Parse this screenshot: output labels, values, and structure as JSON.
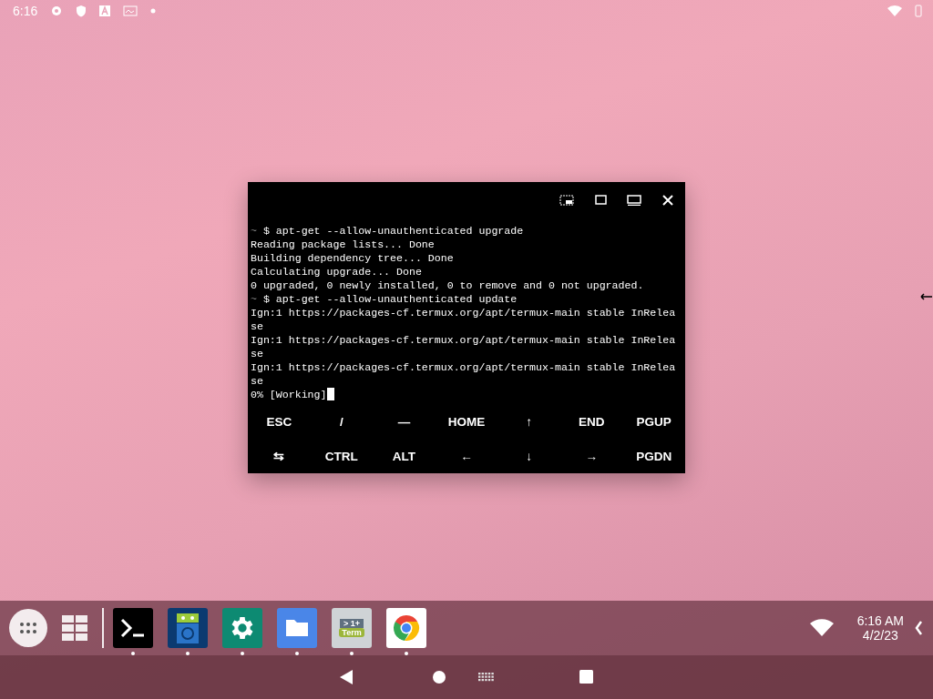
{
  "status_bar": {
    "time": "6:16"
  },
  "terminal": {
    "lines": [
      {
        "prompt": "~",
        "text": "$ apt-get --allow-unauthenticated upgrade",
        "cursor": false
      },
      {
        "text": "Reading package lists... Done",
        "cursor": false
      },
      {
        "text": "Building dependency tree... Done",
        "cursor": false
      },
      {
        "text": "Calculating upgrade... Done",
        "cursor": false
      },
      {
        "text": "0 upgraded, 0 newly installed, 0 to remove and 0 not upgraded.",
        "cursor": false
      },
      {
        "prompt": "~",
        "text": "$ apt-get --allow-unauthenticated update",
        "cursor": false
      },
      {
        "text": "Ign:1 https://packages-cf.termux.org/apt/termux-main stable InRelea",
        "cursor": false
      },
      {
        "text": "se",
        "cursor": false
      },
      {
        "text": "Ign:1 https://packages-cf.termux.org/apt/termux-main stable InRelea",
        "cursor": false
      },
      {
        "text": "se",
        "cursor": false
      },
      {
        "text": "Ign:1 https://packages-cf.termux.org/apt/termux-main stable InRelea",
        "cursor": false
      },
      {
        "text": "se",
        "cursor": false
      },
      {
        "text": "0% [Working]",
        "cursor": true
      }
    ],
    "extra_keys": [
      [
        "ESC",
        "/",
        "—",
        "HOME",
        "↑",
        "END",
        "PGUP"
      ],
      [
        "⇆",
        "CTRL",
        "ALT",
        "←",
        "↓",
        "→",
        "PGDN"
      ]
    ]
  },
  "taskbar": {
    "apps": [
      {
        "kind": "terminal",
        "running": true
      },
      {
        "kind": "droid",
        "running": true
      },
      {
        "kind": "settings",
        "running": true
      },
      {
        "kind": "files",
        "running": true
      },
      {
        "kind": "term",
        "running": true,
        "icon_text": [
          "> 1+",
          "Term"
        ]
      },
      {
        "kind": "browser",
        "running": true
      }
    ],
    "clock": {
      "time": "6:16 AM",
      "date": "4/2/23"
    }
  }
}
